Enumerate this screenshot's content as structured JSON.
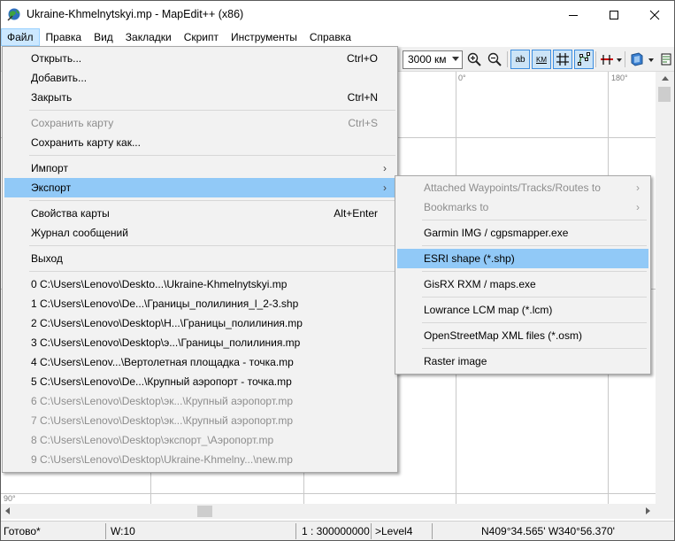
{
  "window": {
    "title": "Ukraine-Khmelnytskyi.mp - MapEdit++ (x86)"
  },
  "menubar": [
    "Файл",
    "Правка",
    "Вид",
    "Закладки",
    "Скрипт",
    "Инструменты",
    "Справка"
  ],
  "toolbar": {
    "scale_value": "3000 км",
    "buttons": [
      {
        "name": "zoom-in-icon"
      },
      {
        "name": "zoom-out-icon"
      },
      {
        "name": "labels-icon",
        "text": "ab"
      },
      {
        "name": "km-icon",
        "text": "KM"
      },
      {
        "name": "grid-icon"
      },
      {
        "name": "nodes-icon"
      },
      {
        "name": "route-icon"
      },
      {
        "name": "layers-icon"
      }
    ]
  },
  "map": {
    "labels": [
      "0°",
      "180°",
      "90°"
    ]
  },
  "file_menu": {
    "items": [
      {
        "label": "Открыть...",
        "shortcut": "Ctrl+O",
        "disabled": false
      },
      {
        "label": "Добавить...",
        "shortcut": "",
        "disabled": false
      },
      {
        "label": "Закрыть",
        "shortcut": "Ctrl+N",
        "disabled": false
      },
      {
        "label": "Сохранить карту",
        "shortcut": "Ctrl+S",
        "disabled": true
      },
      {
        "label": "Сохранить карту как...",
        "shortcut": "",
        "disabled": false
      },
      {
        "label": "Импорт",
        "shortcut": "",
        "disabled": false,
        "submenu": true
      },
      {
        "label": "Экспорт",
        "shortcut": "",
        "disabled": false,
        "submenu": true,
        "highlighted": true
      },
      {
        "label": "Свойства карты",
        "shortcut": "Alt+Enter",
        "disabled": false
      },
      {
        "label": "Журнал сообщений",
        "shortcut": "",
        "disabled": false
      },
      {
        "label": "Выход",
        "shortcut": "",
        "disabled": false
      }
    ],
    "recent_files": [
      {
        "label": "0 C:\\Users\\Lenovo\\Deskto...\\Ukraine-Khmelnytskyi.mp",
        "disabled": false
      },
      {
        "label": "1 C:\\Users\\Lenovo\\De...\\Границы_полилиния_l_2-3.shp",
        "disabled": false
      },
      {
        "label": "2 C:\\Users\\Lenovo\\Desktop\\Н...\\Границы_полилиния.mp",
        "disabled": false
      },
      {
        "label": "3 C:\\Users\\Lenovo\\Desktop\\э...\\Границы_полилиния.mp",
        "disabled": false
      },
      {
        "label": "4 C:\\Users\\Lenov...\\Вертолетная площадка - точка.mp",
        "disabled": false
      },
      {
        "label": "5 C:\\Users\\Lenovo\\De...\\Крупный аэропорт - точка.mp",
        "disabled": false
      },
      {
        "label": "6 C:\\Users\\Lenovo\\Desktop\\эк...\\Крупный аэропорт.mp",
        "disabled": true
      },
      {
        "label": "7 C:\\Users\\Lenovo\\Desktop\\эк...\\Крупный аэропорт.mp",
        "disabled": true
      },
      {
        "label": "8 C:\\Users\\Lenovo\\Desktop\\экспорт_\\Аэропорт.mp",
        "disabled": true
      },
      {
        "label": "9 C:\\Users\\Lenovo\\Desktop\\Ukraine-Khmelny...\\new.mp",
        "disabled": true
      }
    ]
  },
  "export_menu": {
    "items": [
      {
        "label": "Attached Waypoints/Tracks/Routes to",
        "disabled": true,
        "submenu": true
      },
      {
        "label": "Bookmarks to",
        "disabled": true,
        "submenu": true
      },
      {
        "label": "Garmin IMG / cgpsmapper.exe",
        "disabled": false
      },
      {
        "label": "ESRI shape (*.shp)",
        "disabled": false,
        "highlighted": true
      },
      {
        "label": "GisRX RXM / maps.exe",
        "disabled": false
      },
      {
        "label": "Lowrance LCM map (*.lcm)",
        "disabled": false
      },
      {
        "label": "OpenStreetMap XML files (*.osm)",
        "disabled": false
      },
      {
        "label": "Raster image",
        "disabled": false
      }
    ]
  },
  "statusbar": {
    "status": "Готово*",
    "width": "W:10",
    "scale": "1 : 300000000",
    "level": ">Level4",
    "coords": "N409°34.565' W340°56.370'"
  },
  "colors": {
    "menu_highlight": "#91c9f7",
    "menubar_active": "#cce8ff",
    "pressed_button": "#cce4f7"
  }
}
